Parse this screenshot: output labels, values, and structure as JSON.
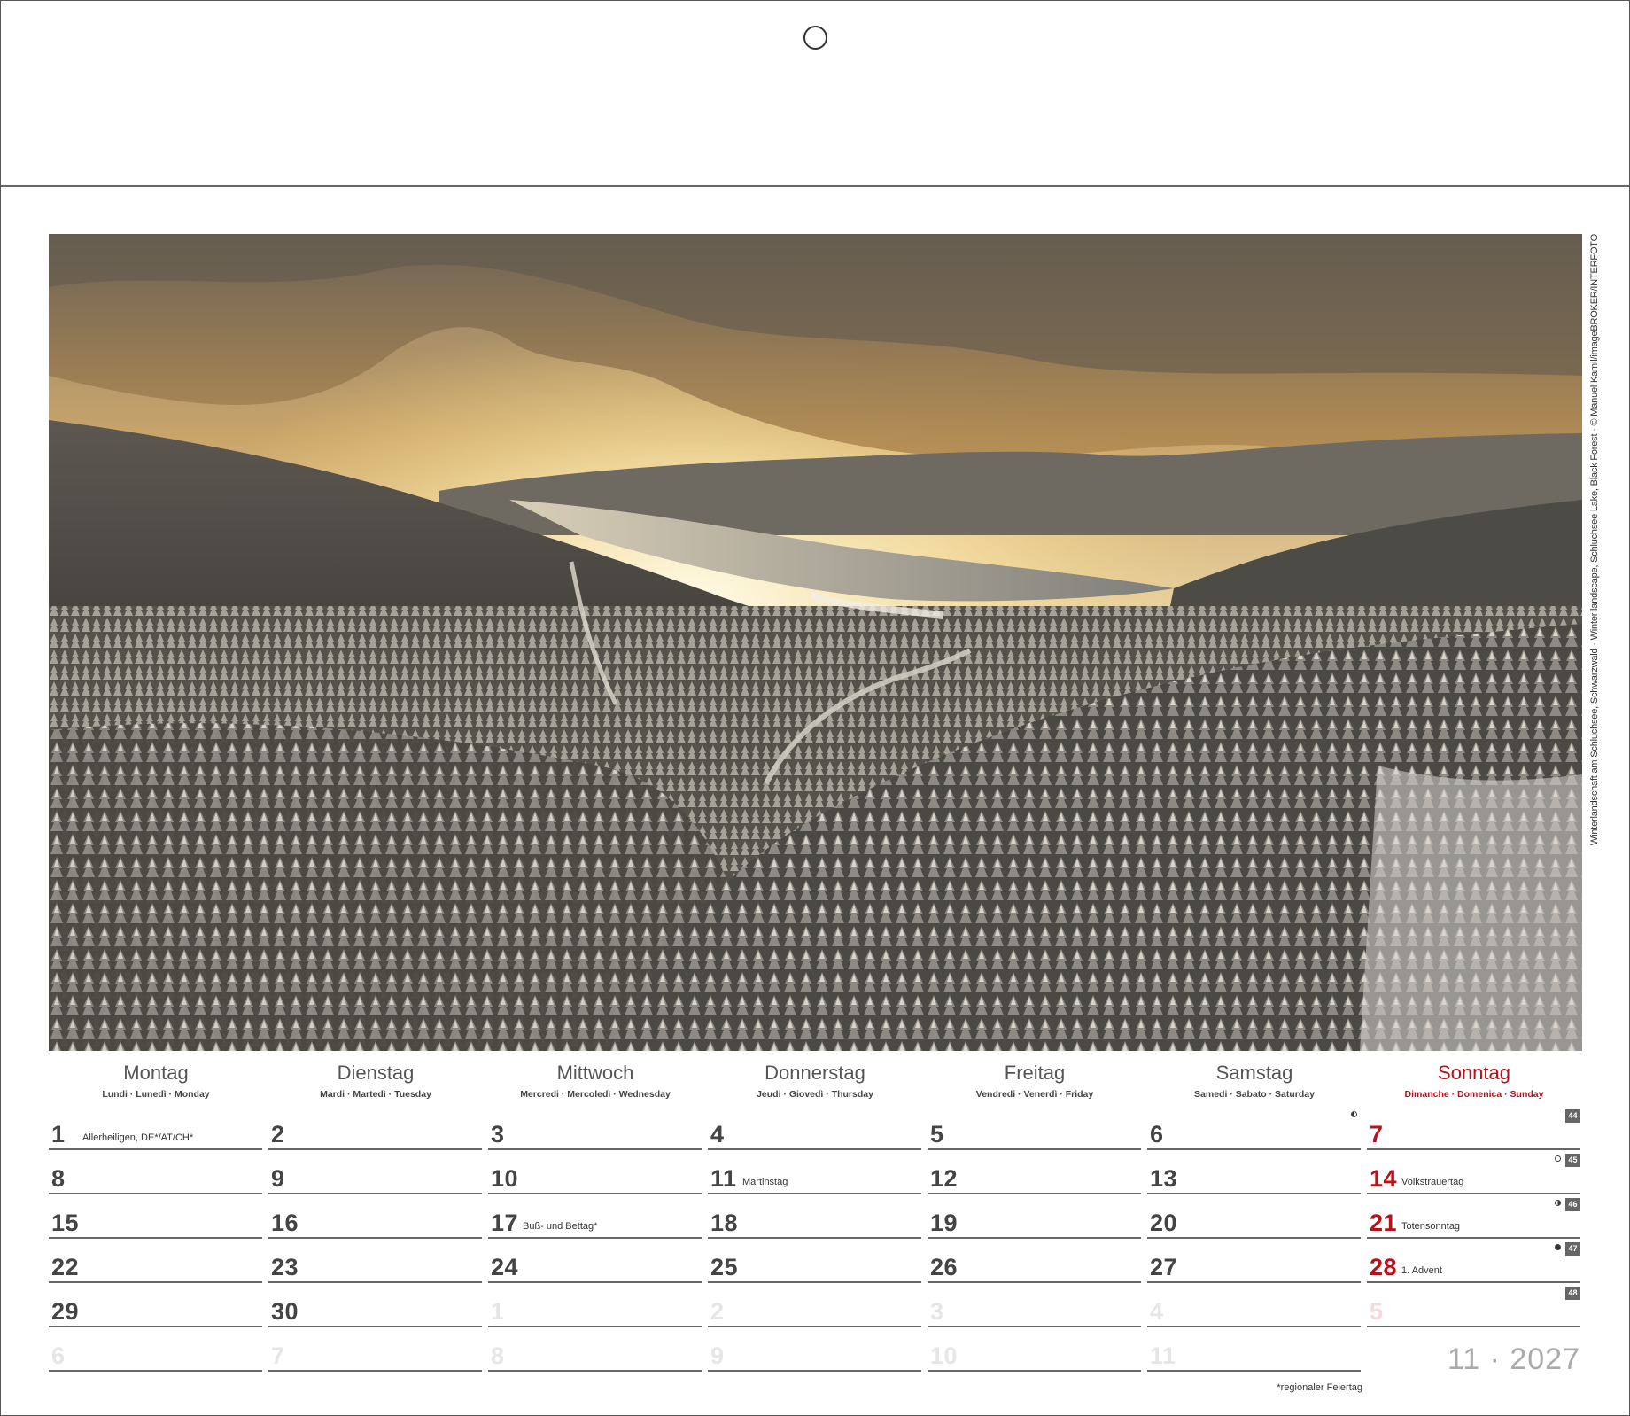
{
  "photo": {
    "credit": "Winterlandschaft am Schluchsee, Schwarzwald · Winter landscape, Schluchsee Lake, Black Forest · © Manuel Kamil/imageBROKER/INTERFOTO",
    "description_icon": "winter-landscape-photo"
  },
  "days": [
    {
      "name": "Montag",
      "sub": "Lundi · Lunedì · Monday"
    },
    {
      "name": "Dienstag",
      "sub": "Mardi · Martedì · Tuesday"
    },
    {
      "name": "Mittwoch",
      "sub": "Mercredi · Mercoledì · Wednesday"
    },
    {
      "name": "Donnerstag",
      "sub": "Jeudi · Giovedì · Thursday"
    },
    {
      "name": "Freitag",
      "sub": "Vendredi · Venerdì · Friday"
    },
    {
      "name": "Samstag",
      "sub": "Samedi · Sabato · Saturday"
    },
    {
      "name": "Sonntag",
      "sub": "Dimanche · Domenica · Sunday"
    }
  ],
  "weeks": [
    {
      "kw": "44",
      "cells": [
        {
          "n": "1",
          "note": "Allerheiligen, DE*/AT/CH*"
        },
        {
          "n": "2"
        },
        {
          "n": "3"
        },
        {
          "n": "4"
        },
        {
          "n": "5"
        },
        {
          "n": "6",
          "moon": "last"
        },
        {
          "n": "7"
        }
      ]
    },
    {
      "kw": "45",
      "cells": [
        {
          "n": "8"
        },
        {
          "n": "9"
        },
        {
          "n": "10"
        },
        {
          "n": "11",
          "note": "Martinstag"
        },
        {
          "n": "12"
        },
        {
          "n": "13"
        },
        {
          "n": "14",
          "note": "Volkstrauertag",
          "moon": "full"
        }
      ]
    },
    {
      "kw": "46",
      "cells": [
        {
          "n": "15"
        },
        {
          "n": "16"
        },
        {
          "n": "17",
          "note": "Buß- und Bettag*"
        },
        {
          "n": "18"
        },
        {
          "n": "19"
        },
        {
          "n": "20"
        },
        {
          "n": "21",
          "note": "Totensonntag",
          "moon": "first"
        }
      ]
    },
    {
      "kw": "47",
      "cells": [
        {
          "n": "22"
        },
        {
          "n": "23"
        },
        {
          "n": "24"
        },
        {
          "n": "25"
        },
        {
          "n": "26"
        },
        {
          "n": "27"
        },
        {
          "n": "28",
          "note": "1. Advent",
          "moon": "new"
        }
      ]
    },
    {
      "kw": "48",
      "cells": [
        {
          "n": "29"
        },
        {
          "n": "30"
        },
        {
          "n": "1",
          "faded": true
        },
        {
          "n": "2",
          "faded": true
        },
        {
          "n": "3",
          "faded": true
        },
        {
          "n": "4",
          "faded": true
        },
        {
          "n": "5",
          "faded": true
        }
      ]
    },
    {
      "kw": "",
      "cells": [
        {
          "n": "6",
          "faded": true
        },
        {
          "n": "7",
          "faded": true
        },
        {
          "n": "8",
          "faded": true
        },
        {
          "n": "9",
          "faded": true
        },
        {
          "n": "10",
          "faded": true
        },
        {
          "n": "11",
          "faded": true
        }
      ]
    }
  ],
  "month_label": "11 · 2027",
  "footnote": "*regionaler Feiertag",
  "colors": {
    "sunday_red": "#b5121b",
    "text_gray": "#4a4a4a",
    "faded_gray": "#e6e6e6",
    "week_badge": "#666666"
  }
}
